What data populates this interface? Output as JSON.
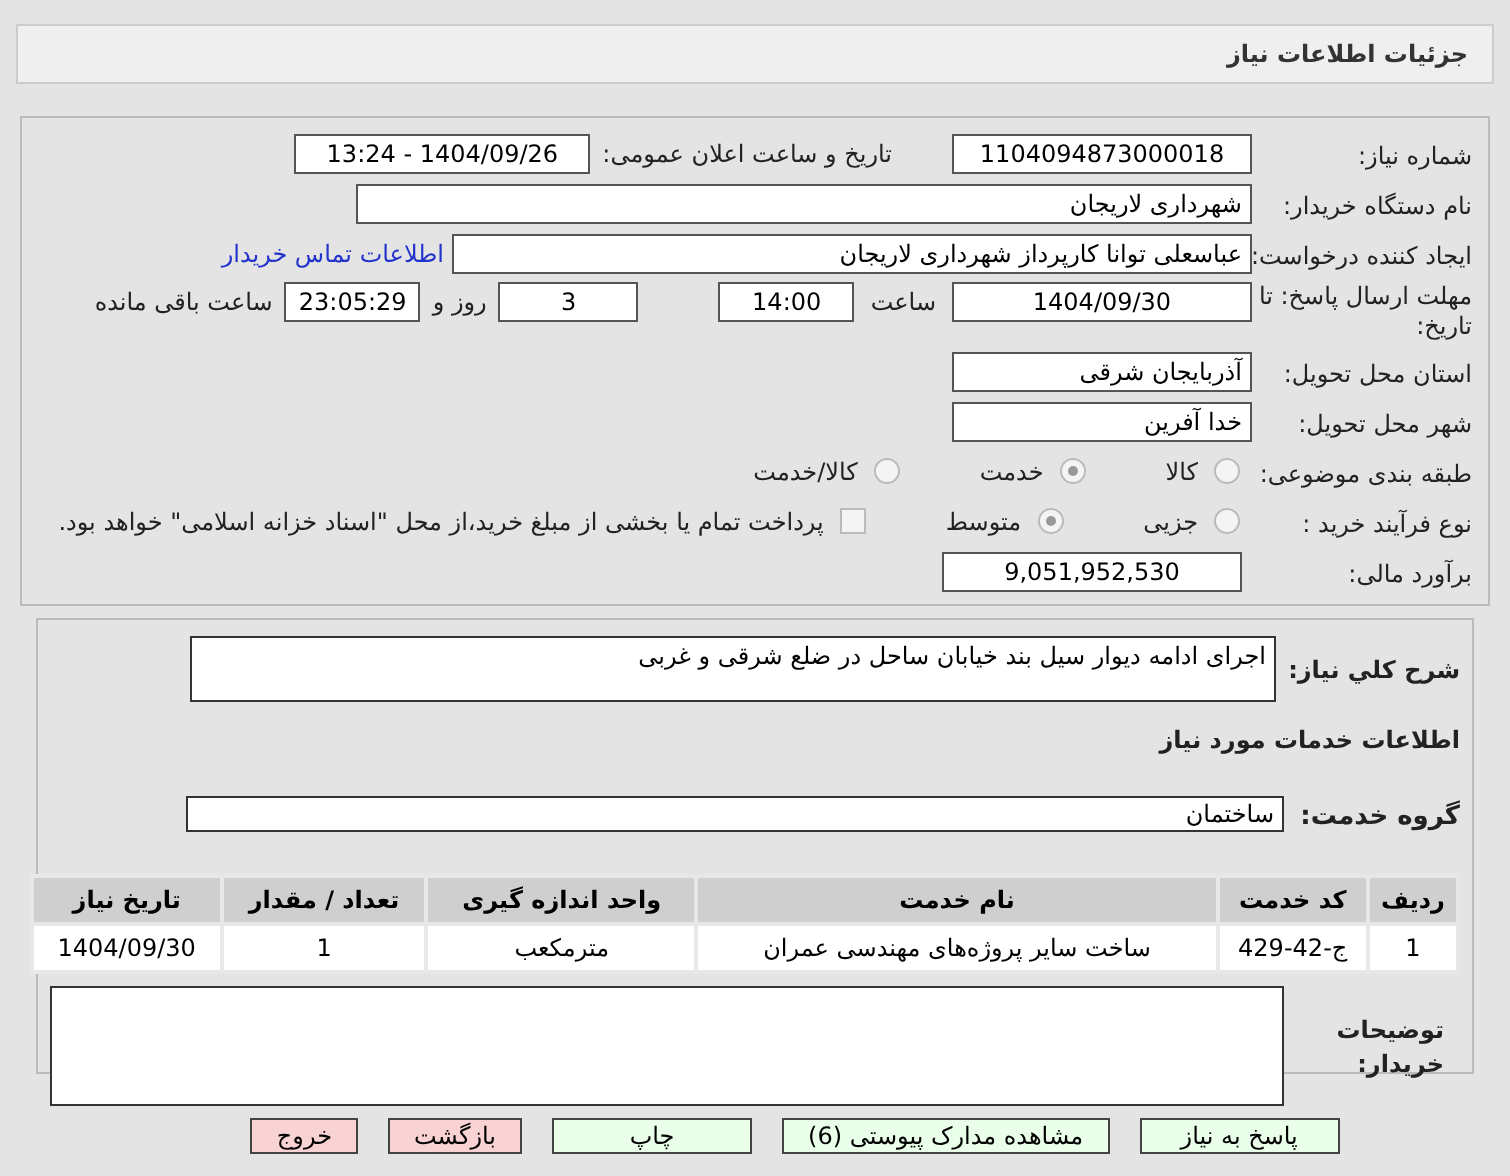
{
  "header": {
    "title": "جزئیات اطلاعات نیاز"
  },
  "info": {
    "need_number": {
      "label": "شماره نیاز:",
      "value": "1104094873000018"
    },
    "announce": {
      "label": "تاریخ و ساعت اعلان عمومی:",
      "value": "1404/09/26 - 13:24"
    },
    "buyer": {
      "label": "نام دستگاه خریدار:",
      "value": "شهرداری لاریجان"
    },
    "creator": {
      "label": "ایجاد کننده درخواست:",
      "value": "عباسعلی توانا کارپرداز شهرداری لاریجان",
      "link": "اطلاعات تماس خریدار"
    },
    "deadline": {
      "label": "مهلت ارسال پاسخ: تا تاریخ:",
      "date": "1404/09/30",
      "time_label": "ساعت",
      "time": "14:00",
      "days": "3",
      "days_label": "روز و",
      "remaining": "23:05:29",
      "remaining_label": "ساعت باقی مانده"
    },
    "province": {
      "label": "استان محل تحویل:",
      "value": "آذربایجان شرقی"
    },
    "city": {
      "label": "شهر محل تحویل:",
      "value": "خدا آفرین"
    },
    "category": {
      "label": "طبقه بندی موضوعی:",
      "options": [
        {
          "label": "کالا",
          "selected": false
        },
        {
          "label": "خدمت",
          "selected": true
        },
        {
          "label": "کالا/خدمت",
          "selected": false
        }
      ]
    },
    "process": {
      "label": "نوع فرآیند خرید :",
      "options": [
        {
          "label": "جزیی",
          "selected": false
        },
        {
          "label": "متوسط",
          "selected": true
        }
      ],
      "checkbox": {
        "label": "پرداخت تمام یا بخشی از مبلغ خرید،از محل \"اسناد خزانه اسلامی\" خواهد بود.",
        "checked": false
      }
    },
    "budget": {
      "label": "برآورد مالی:",
      "value": "9,051,952,530"
    }
  },
  "details": {
    "description": {
      "label": "شرح کلي نياز:",
      "value": "اجرای ادامه دیوار سیل بند خیابان ساحل در ضلع شرقی و غربی"
    },
    "services_title": "اطلاعات خدمات مورد نیاز",
    "service_group": {
      "label": "گروه خدمت:",
      "value": "ساختمان"
    },
    "table": {
      "columns": [
        "ردیف",
        "کد خدمت",
        "نام خدمت",
        "واحد اندازه گیری",
        "تعداد / مقدار",
        "تاریخ نیاز"
      ],
      "rows": [
        [
          "1",
          "ج-42-429",
          "ساخت سایر پروژه‌های مهندسی عمران",
          "مترمکعب",
          "1",
          "1404/09/30"
        ]
      ]
    },
    "notes": {
      "label": "توضیحات خریدار:"
    }
  },
  "buttons": [
    {
      "label": "پاسخ به نیاز",
      "kind": "primary"
    },
    {
      "label": "مشاهده مدارک پیوستی (6)",
      "kind": "primary"
    },
    {
      "label": "چاپ",
      "kind": "primary"
    },
    {
      "label": "بازگشت",
      "kind": "danger"
    },
    {
      "label": "خروج",
      "kind": "danger"
    }
  ]
}
